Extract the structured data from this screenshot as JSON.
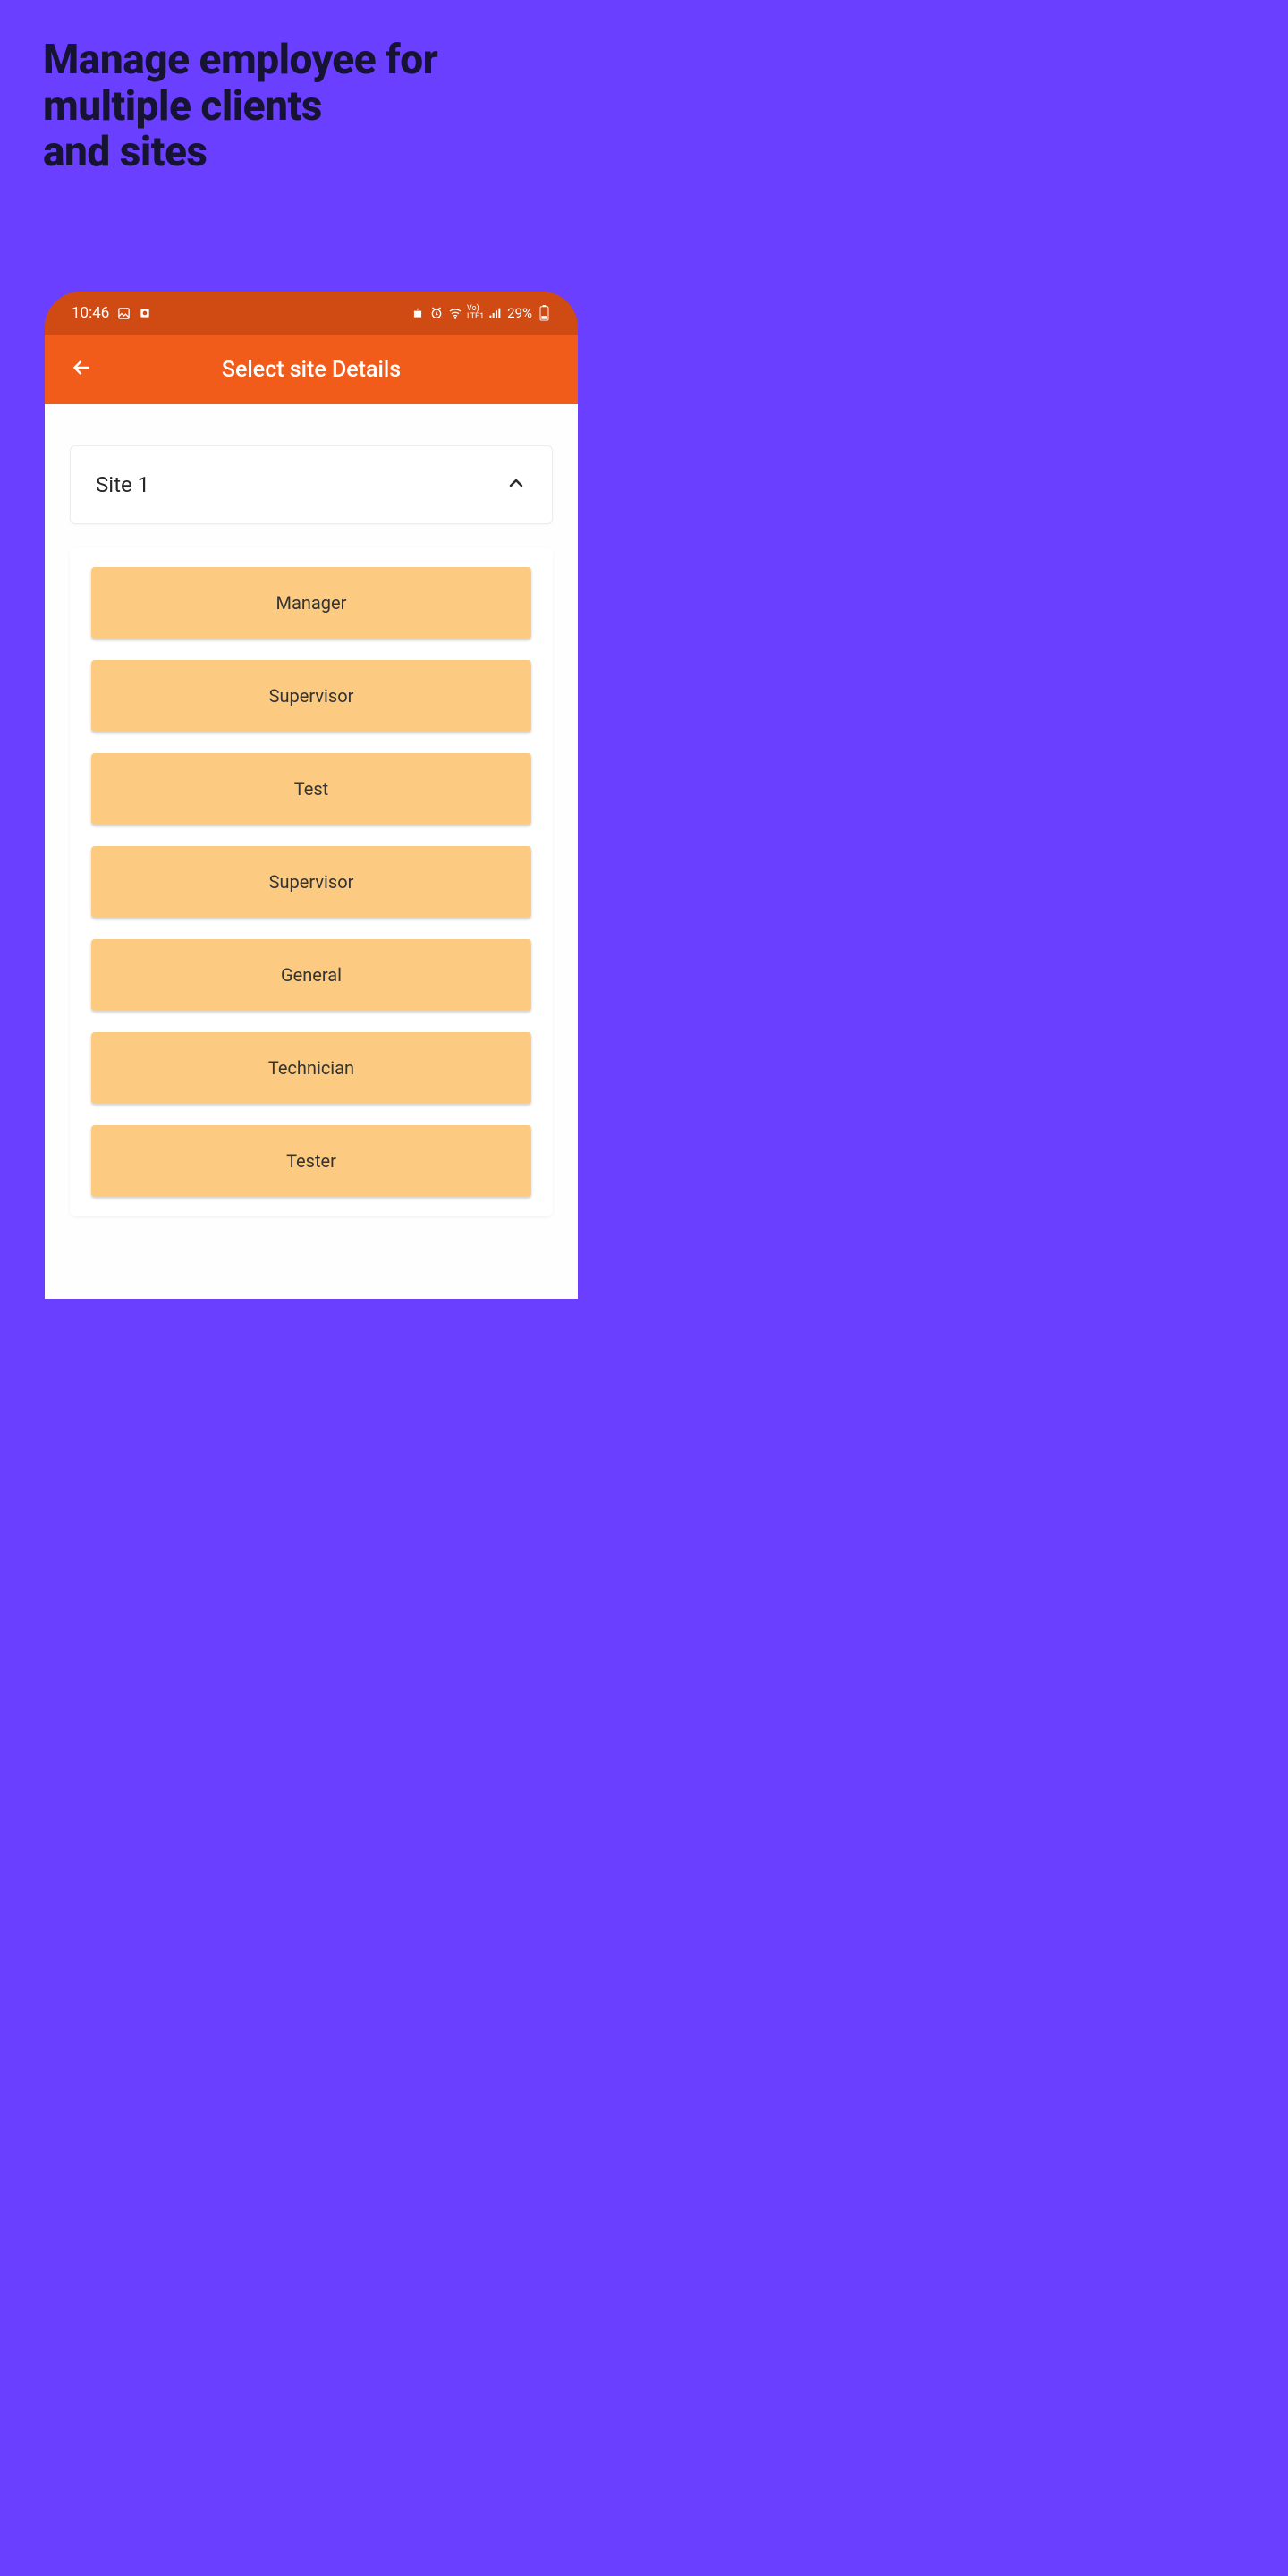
{
  "marketing": {
    "headline_line1": "Manage employee for",
    "headline_line2": "multiple clients",
    "headline_line3": "and sites"
  },
  "status_bar": {
    "time": "10:46",
    "battery_text": "29%"
  },
  "app_bar": {
    "title": "Select site Details"
  },
  "site_select": {
    "value": "Site 1"
  },
  "roles": [
    {
      "label": "Manager"
    },
    {
      "label": "Supervisor"
    },
    {
      "label": "Test"
    },
    {
      "label": "Supervisor"
    },
    {
      "label": "General"
    },
    {
      "label": "Technician"
    },
    {
      "label": "Tester"
    }
  ]
}
